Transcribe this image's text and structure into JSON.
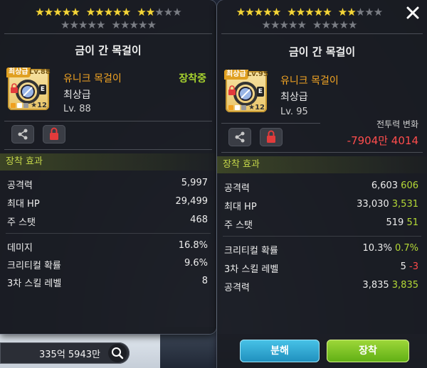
{
  "colors": {
    "name_orange": "#f5a623",
    "equipped_green": "#a7d32f",
    "diff_green": "#b5d936",
    "diff_red": "#ff4a4a"
  },
  "left": {
    "stars_row1": [
      1,
      1,
      1,
      1,
      1,
      1,
      1,
      1,
      1,
      1,
      1,
      1,
      0,
      0,
      0
    ],
    "stars_row2": [
      0,
      0,
      0,
      0,
      0,
      0,
      0,
      0,
      0,
      0
    ],
    "title": "금이 간 목걸이",
    "item": {
      "grade_tag": "최상급",
      "lv_tag": "Lv.88",
      "star_count": "12",
      "name": "유니크 목걸이",
      "grade": "최상급",
      "level": "Lv. 88",
      "equipped": "장착중"
    },
    "section_title": "장착 효과",
    "stats_a": [
      {
        "label": "공격력",
        "value": "5,997"
      },
      {
        "label": "최대 HP",
        "value": "29,499"
      },
      {
        "label": "주 스탯",
        "value": "468"
      }
    ],
    "stats_b": [
      {
        "label": "데미지",
        "value": "16.8%"
      },
      {
        "label": "크리티컬 확률",
        "value": "9.6%"
      },
      {
        "label": "3차 스킬 레벨",
        "value": "8"
      }
    ],
    "meso": "335억 5943만"
  },
  "right": {
    "stars_row1": [
      1,
      1,
      1,
      1,
      1,
      1,
      1,
      1,
      1,
      1,
      1,
      1,
      0,
      0,
      0
    ],
    "stars_row2": [
      0,
      0,
      0,
      0,
      0,
      0,
      0,
      0,
      0,
      0
    ],
    "title": "금이 간 목걸이",
    "item": {
      "grade_tag": "최상급",
      "lv_tag": "Lv.95",
      "star_count": "12",
      "name": "유니크 목걸이",
      "grade": "최상급",
      "level": "Lv. 95"
    },
    "power_label": "전투력 변화",
    "power_value": "-7904만 4014",
    "section_title": "장착 효과",
    "stats_a": [
      {
        "label": "공격력",
        "value": "6,603",
        "diff": "606",
        "sign": "pos"
      },
      {
        "label": "최대 HP",
        "value": "33,030",
        "diff": "3,531",
        "sign": "pos"
      },
      {
        "label": "주 스탯",
        "value": "519",
        "diff": "51",
        "sign": "pos"
      }
    ],
    "stats_b": [
      {
        "label": "크리티컬 확률",
        "value": "10.3%",
        "diff": "0.7%",
        "sign": "pos"
      },
      {
        "label": "3차 스킬 레벨",
        "value": "5",
        "diff": "-3",
        "sign": "neg"
      },
      {
        "label": "공격력",
        "value": "3,835",
        "diff": "3,835",
        "sign": "pos"
      }
    ],
    "btn_disassemble": "분해",
    "btn_equip": "장착"
  }
}
